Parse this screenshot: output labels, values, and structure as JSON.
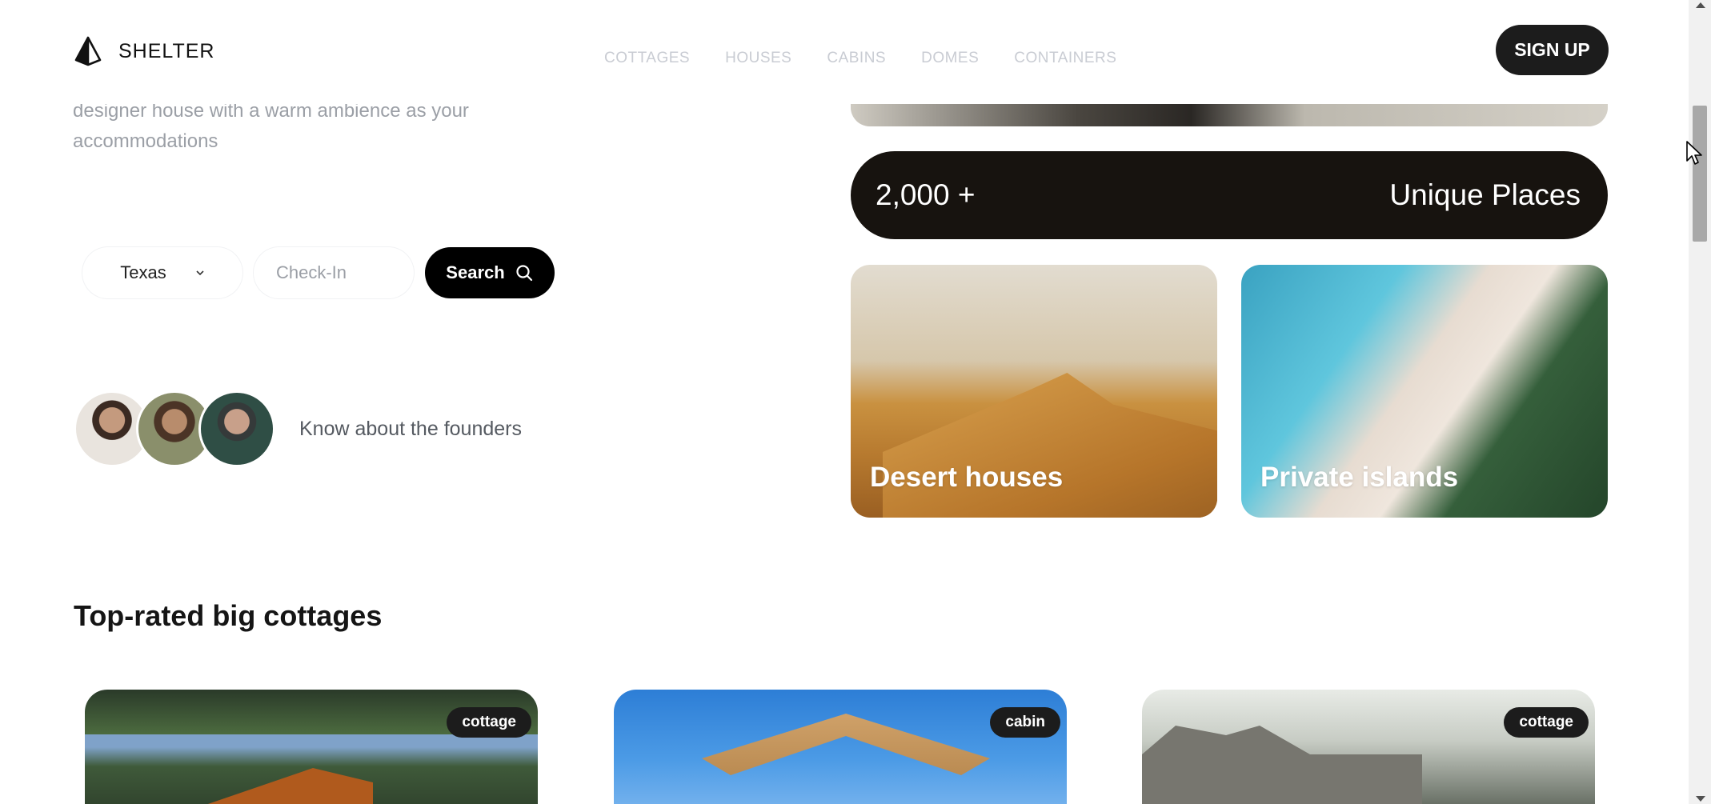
{
  "header": {
    "logo_text": "SHELTER",
    "nav": [
      "COTTAGES",
      "HOUSES",
      "CABINS",
      "DOMES",
      "CONTAINERS"
    ],
    "signup_label": "SIGN UP"
  },
  "hero": {
    "description": "designer house with a warm ambience as your accommodations",
    "search": {
      "location_value": "Texas",
      "checkin_placeholder": "Check-In",
      "button_label": "Search"
    },
    "founders_text": "Know about the founders"
  },
  "stats": {
    "number": "2,000 +",
    "label": "Unique Places"
  },
  "categories": [
    {
      "label": "Desert houses"
    },
    {
      "label": "Private islands"
    }
  ],
  "section": {
    "title": "Top-rated big cottages",
    "listings": [
      {
        "tag": "cottage"
      },
      {
        "tag": "cabin"
      },
      {
        "tag": "cottage"
      }
    ]
  },
  "icons": {
    "logo": "shelter-logo-icon",
    "search": "search-icon",
    "chevron": "chevron-down-icon",
    "cursor": "mouse-cursor-icon"
  },
  "colors": {
    "primary": "#1c1c1c",
    "stat_bg": "#17130f",
    "muted_text": "#9b9fa6",
    "nav_text": "#c9ccd3"
  }
}
